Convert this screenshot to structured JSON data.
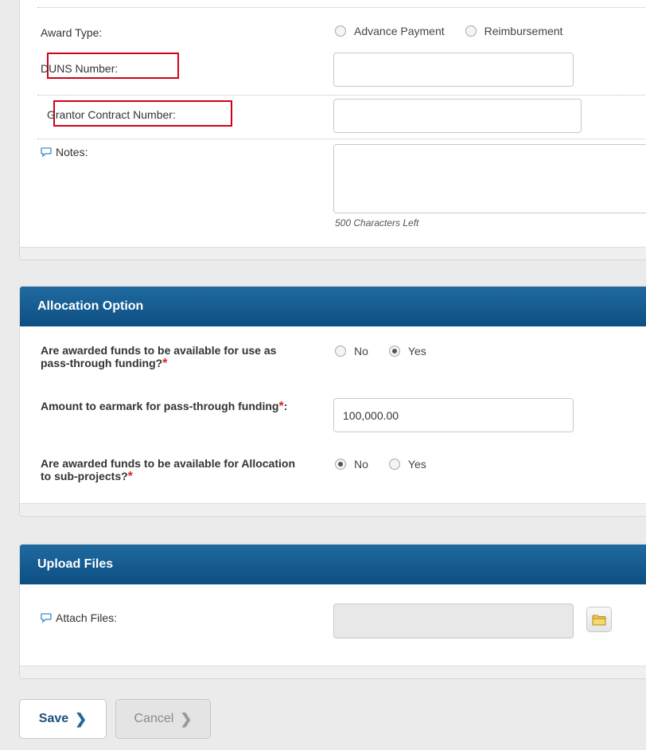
{
  "award_panel": {
    "award_type": {
      "label": "Award Type:",
      "options": [
        {
          "label": "Advance Payment",
          "checked": false
        },
        {
          "label": "Reimbursement",
          "checked": false
        }
      ]
    },
    "duns": {
      "label": "DUNS Number:",
      "value": ""
    },
    "grantor_contract": {
      "label": "Grantor Contract Number:",
      "value": ""
    },
    "notes": {
      "label": "Notes:",
      "value": "",
      "characters_left": "500 Characters Left"
    }
  },
  "allocation_panel": {
    "title": "Allocation Option",
    "pass_through": {
      "label": "Are awarded funds to be available for use as pass-through funding?",
      "required_mark": "*",
      "options": [
        {
          "label": "No",
          "checked": false
        },
        {
          "label": "Yes",
          "checked": true
        }
      ]
    },
    "earmark": {
      "label": "Amount to earmark for pass-through funding",
      "required_mark": "*",
      "suffix": ":",
      "value": "100,000.00"
    },
    "sub_projects": {
      "label": "Are awarded funds to be available for Allocation to sub-projects?",
      "required_mark": "*",
      "options": [
        {
          "label": "No",
          "checked": true
        },
        {
          "label": "Yes",
          "checked": false
        }
      ]
    }
  },
  "upload_panel": {
    "title": "Upload Files",
    "attach": {
      "label": "Attach Files:",
      "value": ""
    }
  },
  "buttons": {
    "save": "Save",
    "cancel": "Cancel"
  },
  "colors": {
    "header_blue": "#0d4f82",
    "required_red": "#d22222",
    "highlight_red": "#d0021b"
  }
}
